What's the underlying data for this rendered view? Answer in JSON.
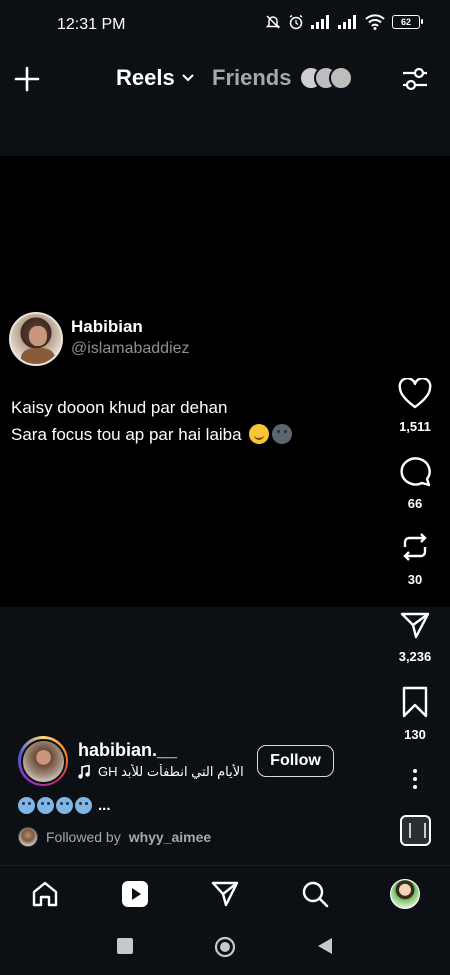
{
  "status_bar": {
    "time": "12:31 PM",
    "battery": "62",
    "icons": [
      "bell-muted-icon",
      "alarm-icon",
      "signal-icon",
      "signal-icon",
      "wifi-icon",
      "battery-icon"
    ]
  },
  "header": {
    "tab_reels": "Reels",
    "tab_friends": "Friends"
  },
  "tweet": {
    "name": "Habibian",
    "handle": "@islamabaddiez",
    "line1": "Kaisy dooon khud par dehan",
    "line2": "Sara focus tou ap par hai laiba"
  },
  "actions": {
    "likes": "1,511",
    "comments": "66",
    "reposts": "30",
    "shares": "3,236",
    "saves": "130"
  },
  "post": {
    "username": "habibian.__",
    "audio": "الأيام التي انطفأت للأبد    GH",
    "follow_label": "Follow",
    "caption_more": "...",
    "followed_by_prefix": "Followed by",
    "followed_by_user": "whyy_aimee"
  },
  "colors": {
    "background": "#0c1014",
    "video": "#000000",
    "secondary_text": "#a8a8a8"
  }
}
